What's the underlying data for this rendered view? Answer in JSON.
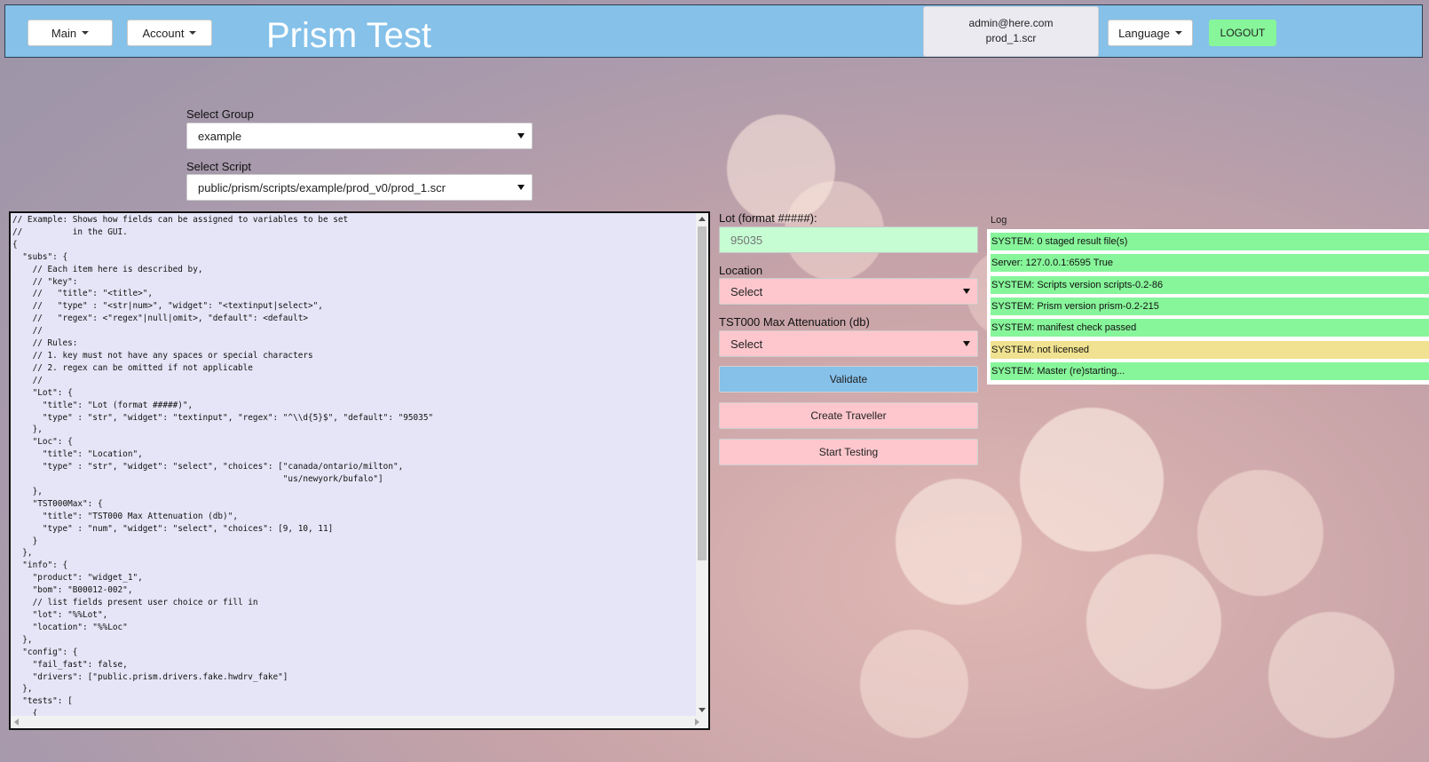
{
  "header": {
    "main_menu_label": "Main",
    "account_menu_label": "Account",
    "app_title": "Prism Test",
    "user_email": "admin@here.com",
    "user_script": "prod_1.scr",
    "language_menu_label": "Language",
    "logout_label": "LOGOUT"
  },
  "form": {
    "group_label": "Select Group",
    "group_value": "example",
    "script_label": "Select Script",
    "script_value": "public/prism/scripts/example/prod_v0/prod_1.scr"
  },
  "code_text": "// Example: Shows how fields can be assigned to variables to be set\n//          in the GUI.\n{\n  \"subs\": {\n    // Each item here is described by,\n    // \"key\":\n    //   \"title\": \"<title>\",\n    //   \"type\" : \"<str|num>\", \"widget\": \"<textinput|select>\",\n    //   \"regex\": <\"regex\"|null|omit>, \"default\": <default>\n    //\n    // Rules:\n    // 1. key must not have any spaces or special characters\n    // 2. regex can be omitted if not applicable\n    //\n    \"Lot\": {\n      \"title\": \"Lot (format #####)\",\n      \"type\" : \"str\", \"widget\": \"textinput\", \"regex\": \"^\\\\d{5}$\", \"default\": \"95035\"\n    },\n    \"Loc\": {\n      \"title\": \"Location\",\n      \"type\" : \"str\", \"widget\": \"select\", \"choices\": [\"canada/ontario/milton\",\n                                                      \"us/newyork/bufalo\"]\n    },\n    \"TST000Max\": {\n      \"title\": \"TST000 Max Attenuation (db)\",\n      \"type\" : \"num\", \"widget\": \"select\", \"choices\": [9, 10, 11]\n    }\n  },\n  \"info\": {\n    \"product\": \"widget_1\",\n    \"bom\": \"B00012-002\",\n    // list fields present user choice or fill in\n    \"lot\": \"%%Lot\",\n    \"location\": \"%%Loc\"\n  },\n  \"config\": {\n    \"fail_fast\": false,\n    \"drivers\": [\"public.prism.drivers.fake.hwdrv_fake\"]\n  },\n  \"tests\": [\n    {",
  "fields": {
    "lot_label": "Lot (format #####):",
    "lot_placeholder": "95035",
    "location_label": "Location",
    "location_value": "Select",
    "tst_label": "TST000 Max Attenuation (db)",
    "tst_value": "Select"
  },
  "buttons": {
    "validate": "Validate",
    "create_traveller": "Create Traveller",
    "start_testing": "Start Testing"
  },
  "log": {
    "title": "Log",
    "entries": [
      {
        "text": "SYSTEM: 0 staged result file(s)",
        "color": "#87f59a"
      },
      {
        "text": "Server: 127.0.0.1:6595 True",
        "color": "#87f59a"
      },
      {
        "text": "SYSTEM: Scripts version scripts-0.2-86",
        "color": "#87f59a"
      },
      {
        "text": "SYSTEM: Prism version prism-0.2-215",
        "color": "#87f59a"
      },
      {
        "text": "SYSTEM: manifest check passed",
        "color": "#87f59a"
      },
      {
        "text": "SYSTEM: not licensed",
        "color": "#f0e290"
      },
      {
        "text": "SYSTEM: Master (re)starting...",
        "color": "#87f59a"
      }
    ]
  },
  "colors": {
    "header_bg": "#85c1e9",
    "validate_bg": "#85c1e9",
    "action_pink": "#fdc7cd",
    "lot_input_bg": "#c6fdd3",
    "logout_bg": "#87f59a"
  }
}
